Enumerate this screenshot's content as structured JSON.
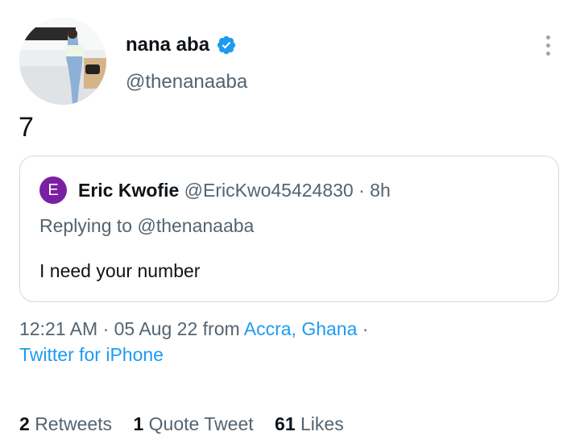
{
  "author": {
    "display_name": "nana aba",
    "handle": "@thenanaaba",
    "verified": true,
    "verified_color": "#1d9bf0"
  },
  "tweet": {
    "text": "7"
  },
  "quoted_tweet": {
    "avatar_letter": "E",
    "avatar_color": "#7b1fa2",
    "name": "Eric Kwofie",
    "handle": "@EricKwo45424830",
    "separator": "·",
    "time": "8h",
    "replying_to_prefix": "Replying to ",
    "replying_to_handle": "@thenanaaba",
    "text": "I need your number"
  },
  "meta": {
    "time": "12:21 AM",
    "separator": "·",
    "date": "05 Aug 22",
    "from_prefix": "from",
    "location": "Accra, Ghana",
    "separator2": "·",
    "source": "Twitter for iPhone"
  },
  "stats": {
    "retweets_count": "2",
    "retweets_label": "Retweets",
    "quotes_count": "1",
    "quotes_label": "Quote Tweet",
    "likes_count": "61",
    "likes_label": "Likes"
  },
  "colors": {
    "link": "#1d9bf0",
    "secondary_text": "#536471",
    "primary_text": "#0f1419"
  },
  "icons": [
    "verified-badge-icon",
    "more-options-icon"
  ]
}
